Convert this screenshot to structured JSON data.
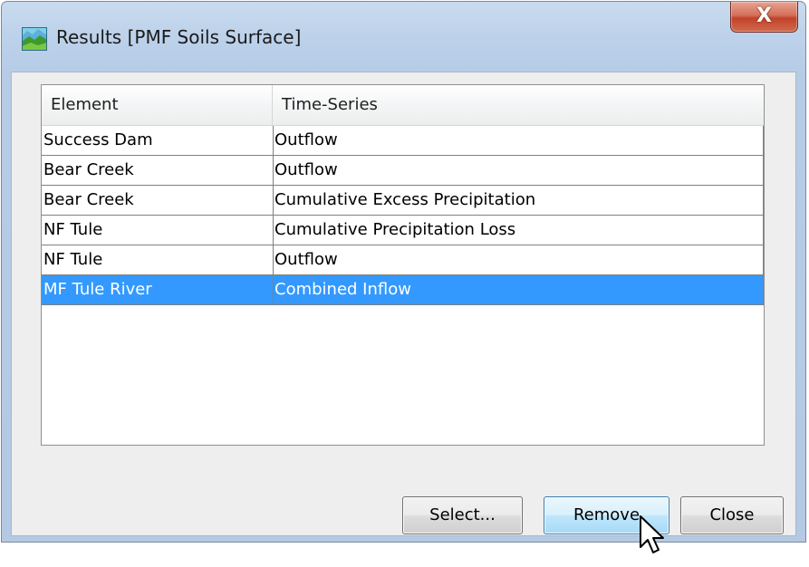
{
  "window": {
    "title": "Results [PMF Soils Surface]",
    "close_glyph": "X"
  },
  "table": {
    "columns": [
      "Element",
      "Time-Series"
    ],
    "rows": [
      {
        "element": "Success Dam",
        "series": "Outflow",
        "selected": false
      },
      {
        "element": "Bear Creek",
        "series": "Outflow",
        "selected": false
      },
      {
        "element": "Bear Creek",
        "series": "Cumulative Excess Precipitation",
        "selected": false
      },
      {
        "element": "NF Tule",
        "series": "Cumulative Precipitation Loss",
        "selected": false
      },
      {
        "element": "NF Tule",
        "series": "Outflow",
        "selected": false
      },
      {
        "element": "MF Tule River",
        "series": "Combined Inflow",
        "selected": true
      }
    ]
  },
  "buttons": {
    "select_label": "Select...",
    "remove_label": "Remove",
    "close_label": "Close"
  },
  "colors": {
    "selection": "#3399ff",
    "close_button": "#c2432b",
    "window_frame": "#b6cce6"
  },
  "icons": {
    "app": "landscape-map-icon",
    "cursor": "mouse-pointer-icon"
  }
}
